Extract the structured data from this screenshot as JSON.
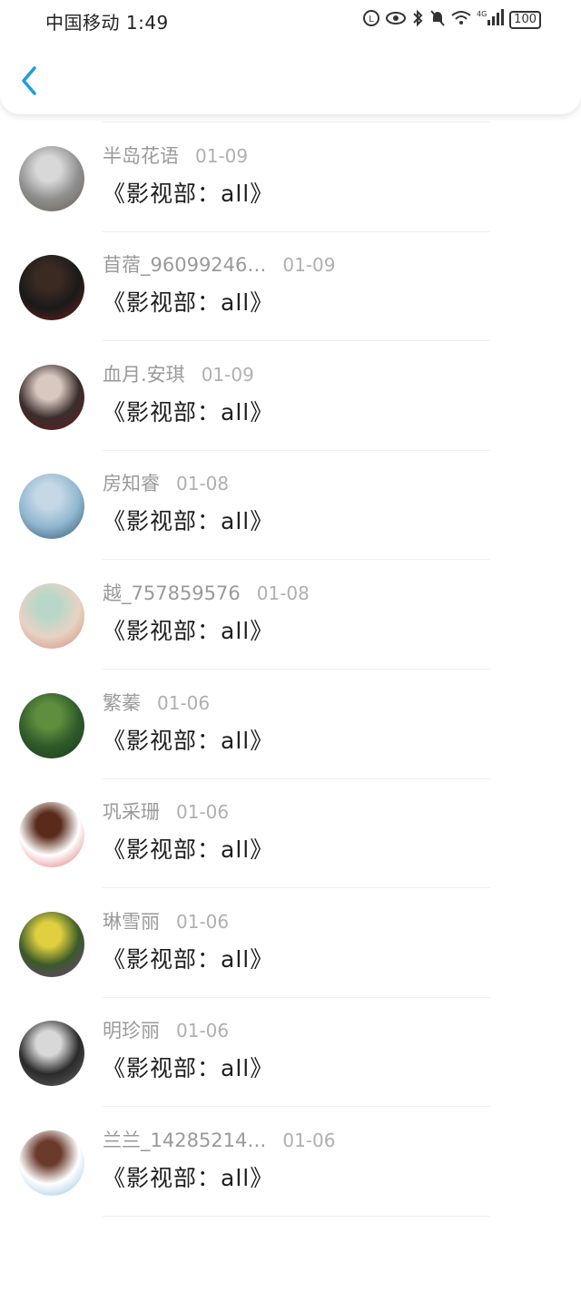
{
  "status_bar": {
    "carrier_time": "中国移动 1:49",
    "battery": "100",
    "network": "4G"
  },
  "header": {
    "back_icon": "chevron-left-icon",
    "accent": "#1e9be0"
  },
  "entries": [
    {
      "name": "",
      "date": "",
      "message": "《影视部：all》",
      "avatar_colors": [
        "#dfe4ef",
        "#b9c4dc",
        "#f7f7fb"
      ]
    },
    {
      "name": "半岛花语",
      "date": "01-09",
      "message": "《影视部：all》",
      "avatar_colors": [
        "#8f8f8f",
        "#d8d8d8",
        "#6b5b4a"
      ]
    },
    {
      "name": "苜蓿_96099246…",
      "date": "01-09",
      "message": "《影视部：all》",
      "avatar_colors": [
        "#1a1a1a",
        "#3b2a22",
        "#7a1f1f"
      ]
    },
    {
      "name": "血月.安琪",
      "date": "01-09",
      "message": "《影视部：all》",
      "avatar_colors": [
        "#3a2d2d",
        "#d9c8c0",
        "#6b1a1a"
      ]
    },
    {
      "name": "房知睿",
      "date": "01-08",
      "message": "《影视部：all》",
      "avatar_colors": [
        "#8fb7cf",
        "#c6d8e6",
        "#2e4e6e"
      ]
    },
    {
      "name": "越_757859576",
      "date": "01-08",
      "message": "《影视部：all》",
      "avatar_colors": [
        "#e8d2c4",
        "#b9d7c9",
        "#d18a7a"
      ]
    },
    {
      "name": "繁蓁",
      "date": "01-06",
      "message": "《影视部：all》",
      "avatar_colors": [
        "#2f5a2a",
        "#5f8f3e",
        "#1c3a1a"
      ]
    },
    {
      "name": "巩采珊",
      "date": "01-06",
      "message": "《影视部：all》",
      "avatar_colors": [
        "#ffffff",
        "#5a2a1a",
        "#e06060"
      ]
    },
    {
      "name": "琳雪丽",
      "date": "01-06",
      "message": "《影视部：all》",
      "avatar_colors": [
        "#3a5a2a",
        "#e0d040",
        "#7a3a8a"
      ]
    },
    {
      "name": "明珍丽",
      "date": "01-06",
      "message": "《影视部：all》",
      "avatar_colors": [
        "#2a2a2a",
        "#d8d8d8",
        "#6a6a6a"
      ]
    },
    {
      "name": "兰兰_14285214…",
      "date": "01-06",
      "message": "《影视部：all》",
      "avatar_colors": [
        "#ffffff",
        "#6a3a2a",
        "#8ab8e0"
      ]
    }
  ]
}
